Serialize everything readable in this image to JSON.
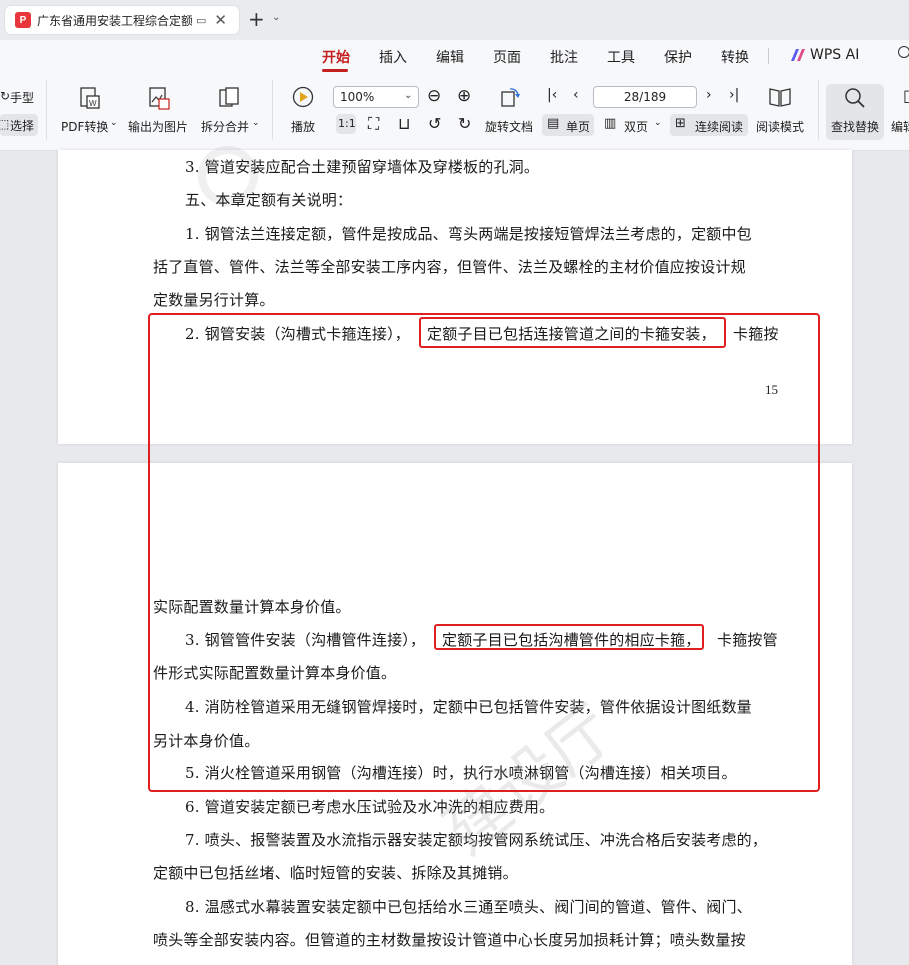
{
  "tab": {
    "title": "广东省通用安装工程综合定额",
    "close": "✕",
    "new_tab": "+",
    "new_tab_arrow": "⌄"
  },
  "menu": {
    "items": [
      "开始",
      "插入",
      "编辑",
      "页面",
      "批注",
      "工具",
      "保护",
      "转换"
    ],
    "active": "开始",
    "ai_label": "WPS AI"
  },
  "toolbar": {
    "hand": "手型",
    "select": "选择",
    "pdf_convert": "PDF转换",
    "export_image": "输出为图片",
    "split_merge": "拆分合并",
    "play": "播放",
    "zoom": "100%",
    "page_indicator": "28/189",
    "rotate_doc": "旋转文档",
    "single_page": "单页",
    "double_page": "双页",
    "continuous": "连续阅读",
    "reading_mode": "阅读模式",
    "find_replace": "查找替换",
    "edit": "编辑"
  },
  "document": {
    "page1_lines": [
      "3.  管道安装应配合土建预留穿墙体及穿楼板的孔洞。",
      "五、本章定额有关说明：",
      "1.  钢管法兰连接定额，管件是按成品、弯头两端是按接短管焊法兰考虑的，定额中包",
      "括了直管、管件、法兰等全部安装工序内容，但管件、法兰及螺栓的主材价值应按设计规",
      "定数量另行计算。",
      "2.  钢管安装（沟槽式卡箍连接），",
      "定额子目已包括连接管道之间的卡箍安装，",
      "卡箍按"
    ],
    "page1_number": "15",
    "page2_lines": [
      "实际配置数量计算本身价值。",
      "3.  钢管管件安装（沟槽管件连接），",
      "定额子目已包括沟槽管件的相应卡箍，",
      "卡箍按管",
      "件形式实际配置数量计算本身价值。",
      "4.  消防栓管道采用无缝钢管焊接时，定额中已包括管件安装，管件依据设计图纸数量",
      "另计本身价值。",
      "5.  消火栓管道采用钢管（沟槽连接）时，执行水喷淋钢管（沟槽连接）相关项目。",
      "6.  管道安装定额已考虑水压试验及水冲洗的相应费用。",
      "7.  喷头、报警装置及水流指示器安装定额均按管网系统试压、冲洗合格后安装考虑的，",
      "定额中已包括丝堵、临时短管的安装、拆除及其摊销。",
      "8.  温感式水幕装置安装定额中已包括给水三通至喷头、阀门间的管道、管件、阀门、",
      "喷头等全部安装内容。但管道的主材数量按设计管道中心长度另加损耗计算；喷头数量按"
    ],
    "watermark": "建设厅"
  },
  "colors": {
    "accent": "#c41f1f",
    "highlight_box": "#e02020"
  }
}
